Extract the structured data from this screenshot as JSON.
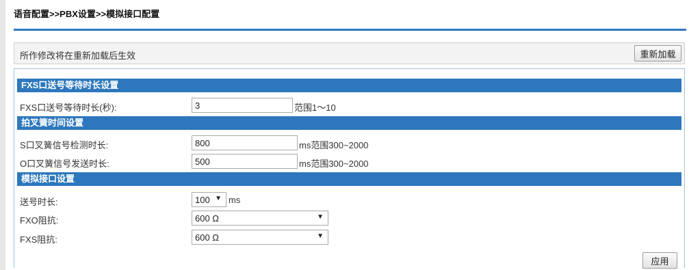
{
  "breadcrumb": "语音配置>>PBX设置>>模拟接口配置",
  "notice": {
    "text": "所作修改将在重新加载后生效",
    "reload_label": "重新加载"
  },
  "fxs_wait": {
    "title": "FXS口送号等待时长设置",
    "label": "FXS口送号等待时长(秒):",
    "value": "3",
    "hint": "范围1～10"
  },
  "hookflash": {
    "title": "拍叉簧时间设置",
    "s_label": "S口叉簧信号检测时长:",
    "s_value": "800",
    "s_hint": "ms范围300~2000",
    "o_label": "O口叉簧信号发送时长:",
    "o_value": "500",
    "o_hint": "ms范围300~2000"
  },
  "analog": {
    "title": "模拟接口设置",
    "send_label": "送号时长:",
    "send_value": "100",
    "send_unit": "ms",
    "fxo_label": "FXO阻抗:",
    "fxo_value": "600 Ω",
    "fxs_label": "FXS阻抗:",
    "fxs_value": "600 Ω"
  },
  "apply_label": "应用",
  "icons": {
    "dropdown": "▼"
  }
}
